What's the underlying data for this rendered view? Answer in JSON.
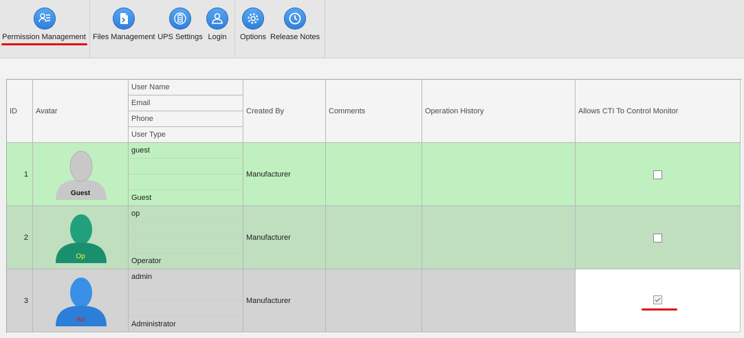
{
  "toolbar": {
    "buttons": [
      {
        "label": "Permission Management",
        "icon": "users-settings-icon",
        "active": true
      },
      {
        "label": "Files Management",
        "icon": "file-transfer-icon"
      },
      {
        "label": "UPS Settings",
        "icon": "battery-icon"
      },
      {
        "label": "Login",
        "icon": "user-icon"
      },
      {
        "label": "Options",
        "icon": "gear-icon"
      },
      {
        "label": "Release Notes",
        "icon": "clock-icon"
      }
    ]
  },
  "grid": {
    "headers": {
      "id": "ID",
      "avatar": "Avatar",
      "user_name": "User Name",
      "email": "Email",
      "phone": "Phone",
      "user_type": "User Type",
      "created_by": "Created By",
      "comments": "Comments",
      "operation_history": "Operation History",
      "allows_cti": "Allows CTI To Control Monitor"
    },
    "rows": [
      {
        "id": "1",
        "avatar_caption": "Guest",
        "user_name": "guest",
        "email": "",
        "phone": "",
        "user_type": "Guest",
        "created_by": "Manufacturer",
        "comments": "",
        "operation_history": "",
        "allows_cti": false
      },
      {
        "id": "2",
        "avatar_caption": "Op",
        "user_name": "op",
        "email": "",
        "phone": "",
        "user_type": "Operator",
        "created_by": "Manufacturer",
        "comments": "",
        "operation_history": "",
        "allows_cti": false
      },
      {
        "id": "3",
        "avatar_caption": "Ad",
        "user_name": "admin",
        "email": "",
        "phone": "",
        "user_type": "Administrator",
        "created_by": "Manufacturer",
        "comments": "",
        "operation_history": "",
        "allows_cti": true
      }
    ]
  },
  "colors": {
    "accent": "#2f7fdb",
    "highlight_underline": "#e01010",
    "row_guest": "#c0f0c0",
    "row_operator": "#bfdfbf",
    "row_admin": "#d3d3d3",
    "avatar_guest": "#c8c8c8",
    "avatar_operator": "#1f9e7a",
    "avatar_admin": "#2b7fd8"
  }
}
